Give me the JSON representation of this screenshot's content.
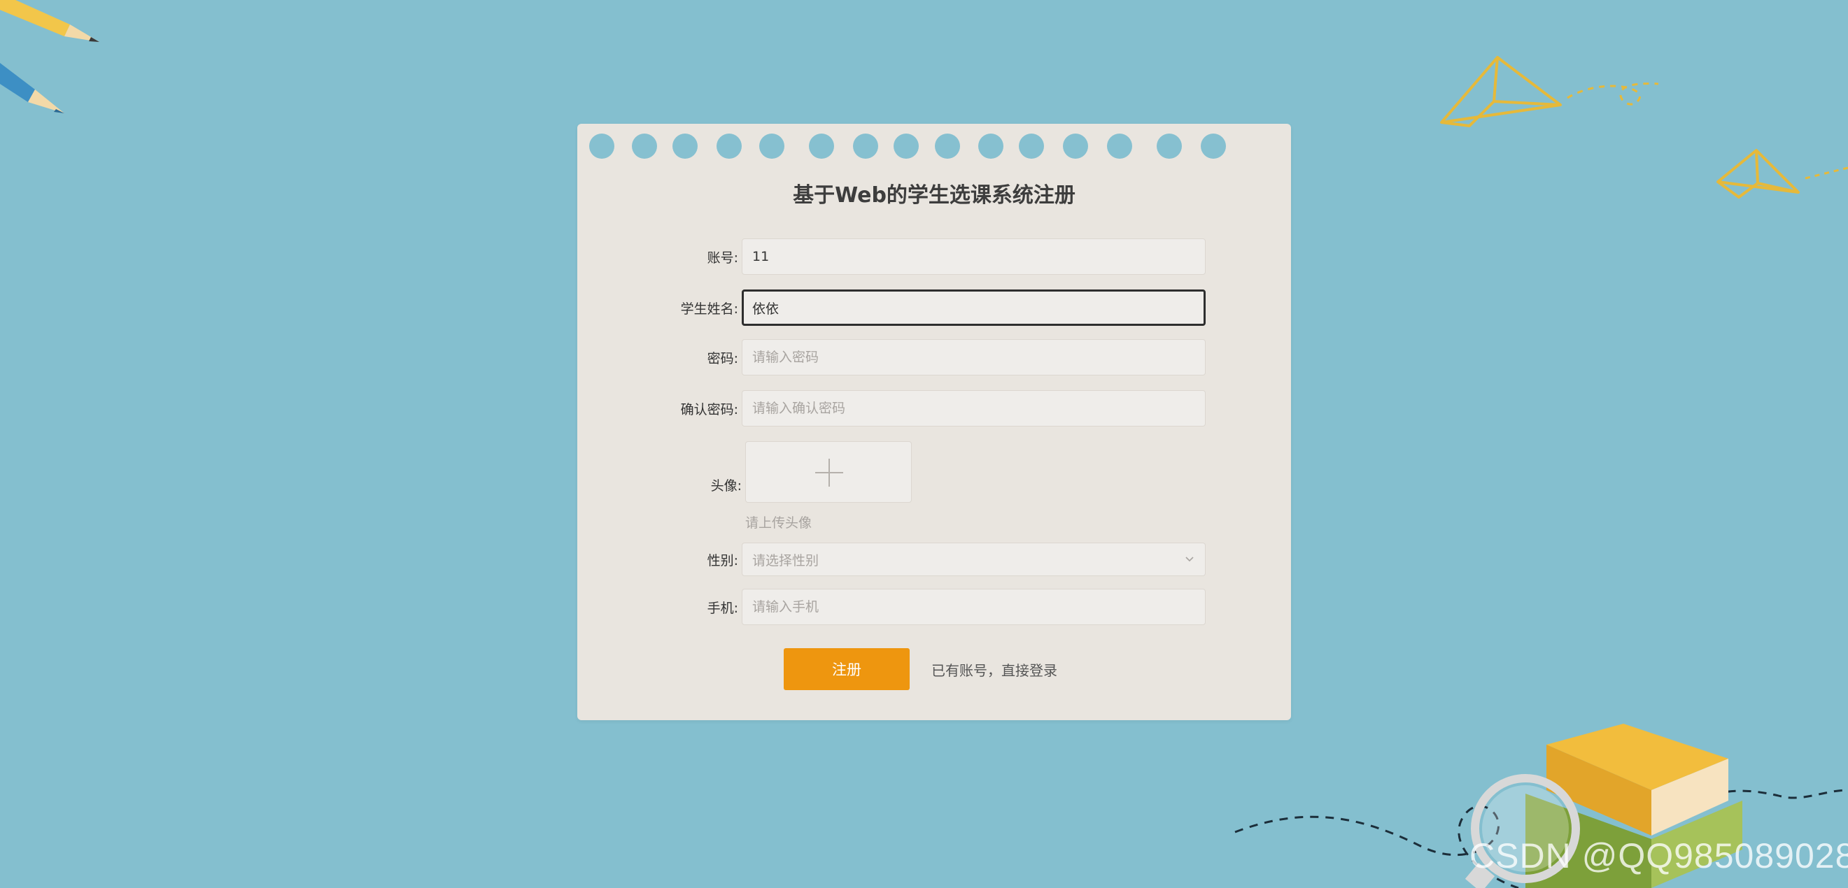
{
  "form": {
    "title": "基于Web的学生选课系统注册",
    "account": {
      "label": "账号:",
      "value": "11"
    },
    "student_name": {
      "label": "学生姓名:",
      "value": "依依"
    },
    "password": {
      "label": "密码:",
      "placeholder": "请输入密码"
    },
    "confirm_password": {
      "label": "确认密码:",
      "placeholder": "请输入确认密码"
    },
    "avatar": {
      "label": "头像:",
      "hint": "请上传头像",
      "icon": "plus-icon"
    },
    "gender": {
      "label": "性别:",
      "placeholder": "请选择性别",
      "icon": "chevron-down-icon"
    },
    "phone": {
      "label": "手机:",
      "placeholder": "请输入手机"
    },
    "submit_label": "注册",
    "login_link": "已有账号，直接登录"
  },
  "watermark": "CSDN @QQ985089028",
  "colors": {
    "background": "#84bfcf",
    "card": "#e9e5df",
    "accent": "#ee960f",
    "title_text": "#3d3d3d"
  }
}
